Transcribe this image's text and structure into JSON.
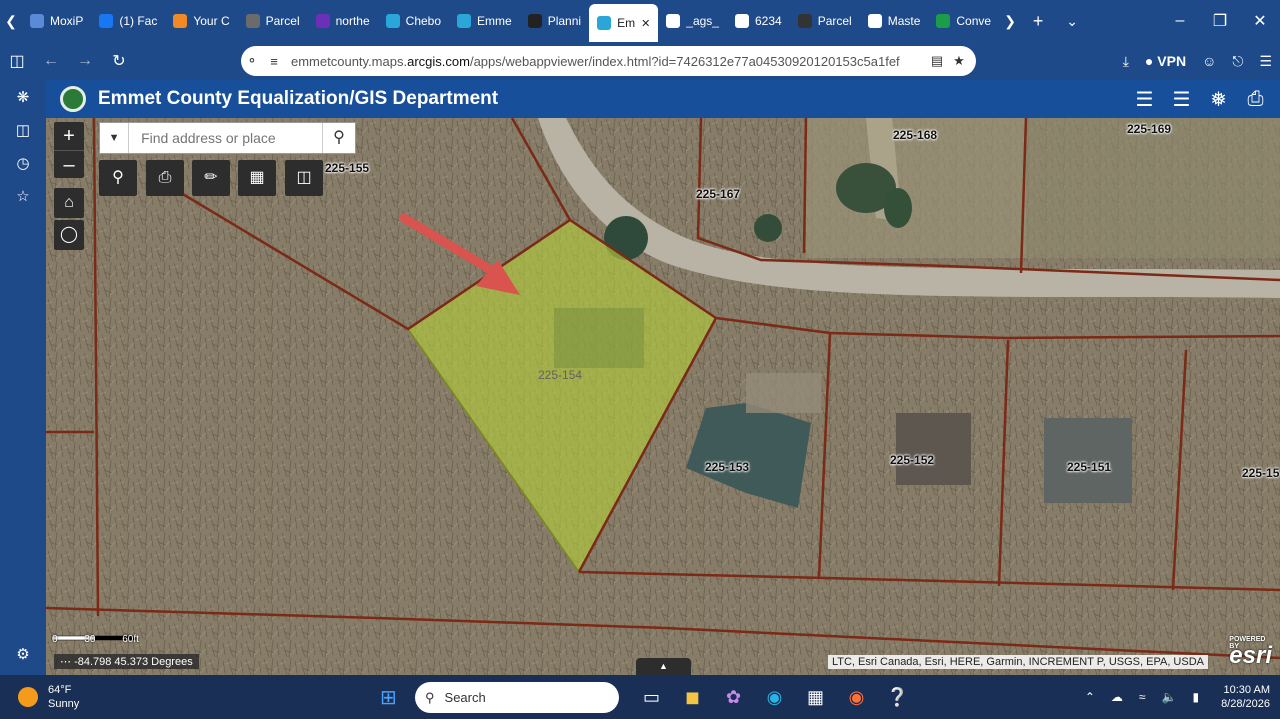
{
  "browser": {
    "tabs": [
      {
        "label": "MoxiP",
        "icon": "moxi-icon",
        "color": "#5b8bd6"
      },
      {
        "label": "(1) Fac",
        "icon": "facebook-icon",
        "color": "#1877f2"
      },
      {
        "label": "Your C",
        "icon": "amazon-icon",
        "color": "#f08a24"
      },
      {
        "label": "Parcel",
        "icon": "parcel-icon",
        "color": "#6b6b6b"
      },
      {
        "label": "northe",
        "icon": "northeast-icon",
        "color": "#6b2fb8"
      },
      {
        "label": "Chebo",
        "icon": "arcgis-icon",
        "color": "#2aa6d8"
      },
      {
        "label": "Emme",
        "icon": "arcgis-icon",
        "color": "#2aa6d8"
      },
      {
        "label": "Planni",
        "icon": "planning-icon",
        "color": "#222"
      },
      {
        "label": "Em",
        "icon": "arcgis-icon",
        "color": "#2aa6d8",
        "active": true
      },
      {
        "label": "_ags_",
        "icon": "document-icon",
        "color": "#fff"
      },
      {
        "label": "6234",
        "icon": "document-icon",
        "color": "#fff"
      },
      {
        "label": "Parcel",
        "icon": "parcel-map-icon",
        "color": "#333"
      },
      {
        "label": "Maste",
        "icon": "document-icon",
        "color": "#fff"
      },
      {
        "label": "Conve",
        "icon": "convert-icon",
        "color": "#1a9c4a"
      }
    ],
    "url_host": "emmetcounty.maps.arcgis.com",
    "url_path": "/apps/webappviewer/index.html?id=7426312e77a04530920120153c5a1fef",
    "url_host_prefix": "emmetcounty.maps.",
    "url_host_main": "arcgis.com",
    "vpn_label": "VPN"
  },
  "app": {
    "title": "Emmet County Equalization/GIS Department",
    "search_placeholder": "Find address or place"
  },
  "map": {
    "parcels": [
      {
        "id": "225-155"
      },
      {
        "id": "225-168"
      },
      {
        "id": "225-169"
      },
      {
        "id": "225-167"
      },
      {
        "id": "225-154",
        "highlighted": true,
        "highlight_color": "#b5cf3a"
      },
      {
        "id": "225-153"
      },
      {
        "id": "225-152"
      },
      {
        "id": "225-151"
      },
      {
        "id": "225-15"
      }
    ],
    "scale_labels": [
      "0",
      "30",
      "60ft"
    ],
    "coordinates": "-84.798 45.373 Degrees",
    "attribution": "LTC, Esri Canada, Esri, HERE, Garmin, INCREMENT P, USGS, EPA, USDA",
    "esri_powered": "POWERED BY",
    "esri_logo": "esri"
  },
  "taskbar": {
    "temp": "64°F",
    "condition": "Sunny",
    "search_label": "Search",
    "time": "10:30 AM",
    "date": "8/28/2026"
  }
}
